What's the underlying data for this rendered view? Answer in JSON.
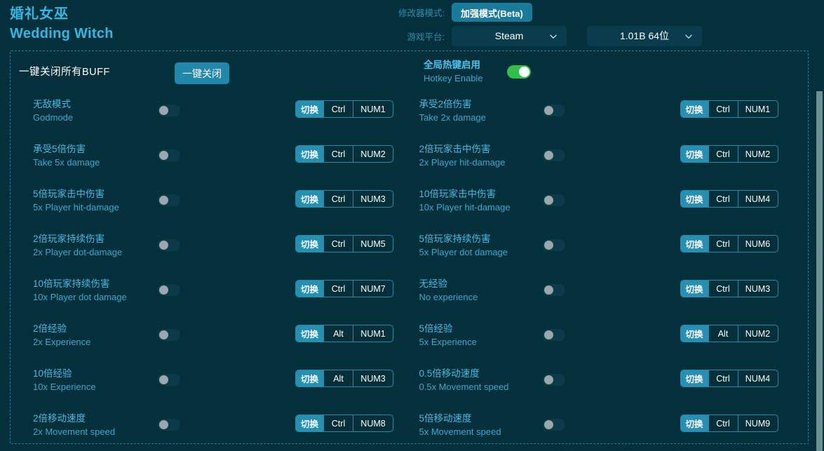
{
  "app": {
    "title_cn": "婚礼女巫",
    "title_en": "Wedding Witch"
  },
  "header": {
    "mode_label": "修改器模式:",
    "mode_button": "加强模式(Beta)",
    "platform_label": "游戏平台:",
    "platform_value": "Steam",
    "version_value": "1.01B 64位",
    "caret_icon": "chevron-down-icon"
  },
  "panel": {
    "all_buff_label": "一键关闭所有BUFF",
    "all_buff_button": "一键关闭",
    "hotkey_cn": "全局热键启用",
    "hotkey_en": "Hotkey Enable",
    "hotkey_enabled": true
  },
  "rows_left": [
    {
      "name_cn": "无敌模式",
      "name_en": "Godmode",
      "enabled": false,
      "action": "切换",
      "modifier": "Ctrl",
      "key": "NUM1"
    },
    {
      "name_cn": "承受5倍伤害",
      "name_en": "Take 5x damage",
      "enabled": false,
      "action": "切换",
      "modifier": "Ctrl",
      "key": "NUM2"
    },
    {
      "name_cn": "5倍玩家击中伤害",
      "name_en": "5x Player hit-damage",
      "enabled": false,
      "action": "切换",
      "modifier": "Ctrl",
      "key": "NUM3"
    },
    {
      "name_cn": "2倍玩家持续伤害",
      "name_en": "2x Player dot-damage",
      "enabled": false,
      "action": "切换",
      "modifier": "Ctrl",
      "key": "NUM5"
    },
    {
      "name_cn": "10倍玩家持续伤害",
      "name_en": "10x Player dot damage",
      "enabled": false,
      "action": "切换",
      "modifier": "Ctrl",
      "key": "NUM7"
    },
    {
      "name_cn": "2倍经验",
      "name_en": "2x Experience",
      "enabled": false,
      "action": "切换",
      "modifier": "Alt",
      "key": "NUM1"
    },
    {
      "name_cn": "10倍经验",
      "name_en": "10x Experience",
      "enabled": false,
      "action": "切换",
      "modifier": "Alt",
      "key": "NUM3"
    },
    {
      "name_cn": "2倍移动速度",
      "name_en": "2x Movement speed",
      "enabled": false,
      "action": "切换",
      "modifier": "Ctrl",
      "key": "NUM8"
    }
  ],
  "rows_right": [
    {
      "name_cn": "承受2倍伤害",
      "name_en": "Take 2x damage",
      "enabled": false,
      "action": "切换",
      "modifier": "Ctrl",
      "key": "NUM1"
    },
    {
      "name_cn": "2倍玩家击中伤害",
      "name_en": "2x Player hit-damage",
      "enabled": false,
      "action": "切换",
      "modifier": "Ctrl",
      "key": "NUM2"
    },
    {
      "name_cn": "10倍玩家击中伤害",
      "name_en": "10x Player hit-damage",
      "enabled": false,
      "action": "切换",
      "modifier": "Ctrl",
      "key": "NUM4"
    },
    {
      "name_cn": "5倍玩家持续伤害",
      "name_en": "5x Player dot damage",
      "enabled": false,
      "action": "切换",
      "modifier": "Ctrl",
      "key": "NUM6"
    },
    {
      "name_cn": "无经验",
      "name_en": "No experience",
      "enabled": false,
      "action": "切换",
      "modifier": "Ctrl",
      "key": "NUM3"
    },
    {
      "name_cn": "5倍经验",
      "name_en": "5x Experience",
      "enabled": false,
      "action": "切换",
      "modifier": "Alt",
      "key": "NUM2"
    },
    {
      "name_cn": "0.5倍移动速度",
      "name_en": "0.5x Movement speed",
      "enabled": false,
      "action": "切换",
      "modifier": "Ctrl",
      "key": "NUM4"
    },
    {
      "name_cn": "5倍移动速度",
      "name_en": "5x Movement speed",
      "enabled": false,
      "action": "切换",
      "modifier": "Ctrl",
      "key": "NUM9"
    }
  ],
  "colors": {
    "background": "#04303c",
    "accent": "#2390b4",
    "text_cyan": "#4ab9e2",
    "toggle_on": "#2fc14a",
    "scrollbar": "#6b8e91"
  }
}
